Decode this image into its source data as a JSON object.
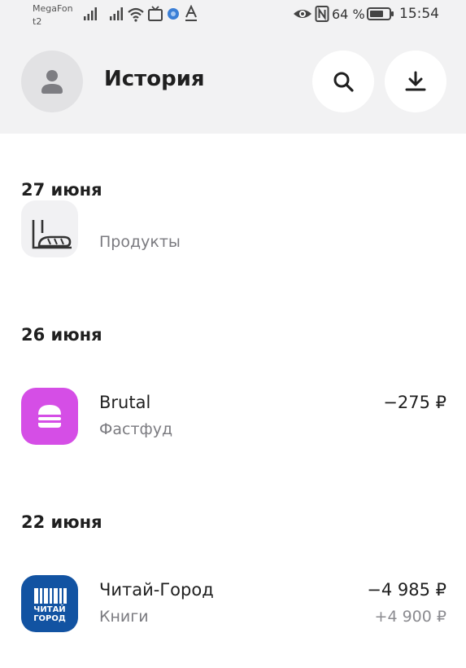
{
  "status_bar": {
    "operator_1": "MegaFon",
    "operator_2": "t2",
    "battery": "64 %",
    "time": "15:54",
    "icons": [
      "signal-icon",
      "signal-icon",
      "wifi-icon",
      "tv-icon",
      "app-dot-icon",
      "a-underline-icon",
      "eye-icon",
      "nfc-icon",
      "battery-icon"
    ]
  },
  "header": {
    "title": "История",
    "icons": [
      "avatar-icon",
      "search-icon",
      "download-icon"
    ]
  },
  "groups": [
    {
      "date": "27 июня",
      "transactions": [
        {
          "name": "",
          "category": "Продукты",
          "amount": "",
          "cashback": "",
          "logo": "bread-icon"
        }
      ]
    },
    {
      "date": "26 июня",
      "transactions": [
        {
          "name": "Brutal",
          "category": "Фастфуд",
          "amount": "−275 ₽",
          "cashback": "",
          "logo": "burger-icon",
          "logo_color": "#d54ee6"
        }
      ]
    },
    {
      "date": "22 июня",
      "transactions": [
        {
          "name": "Читай-Город",
          "category": "Книги",
          "amount": "−4 985 ₽",
          "cashback": "+4 900 ₽",
          "logo": "chitai-gorod-logo",
          "logo_color": "#1253a2",
          "logo_text_1": "ЧИТАЙ",
          "logo_text_2": "ГОРОД"
        }
      ]
    }
  ]
}
